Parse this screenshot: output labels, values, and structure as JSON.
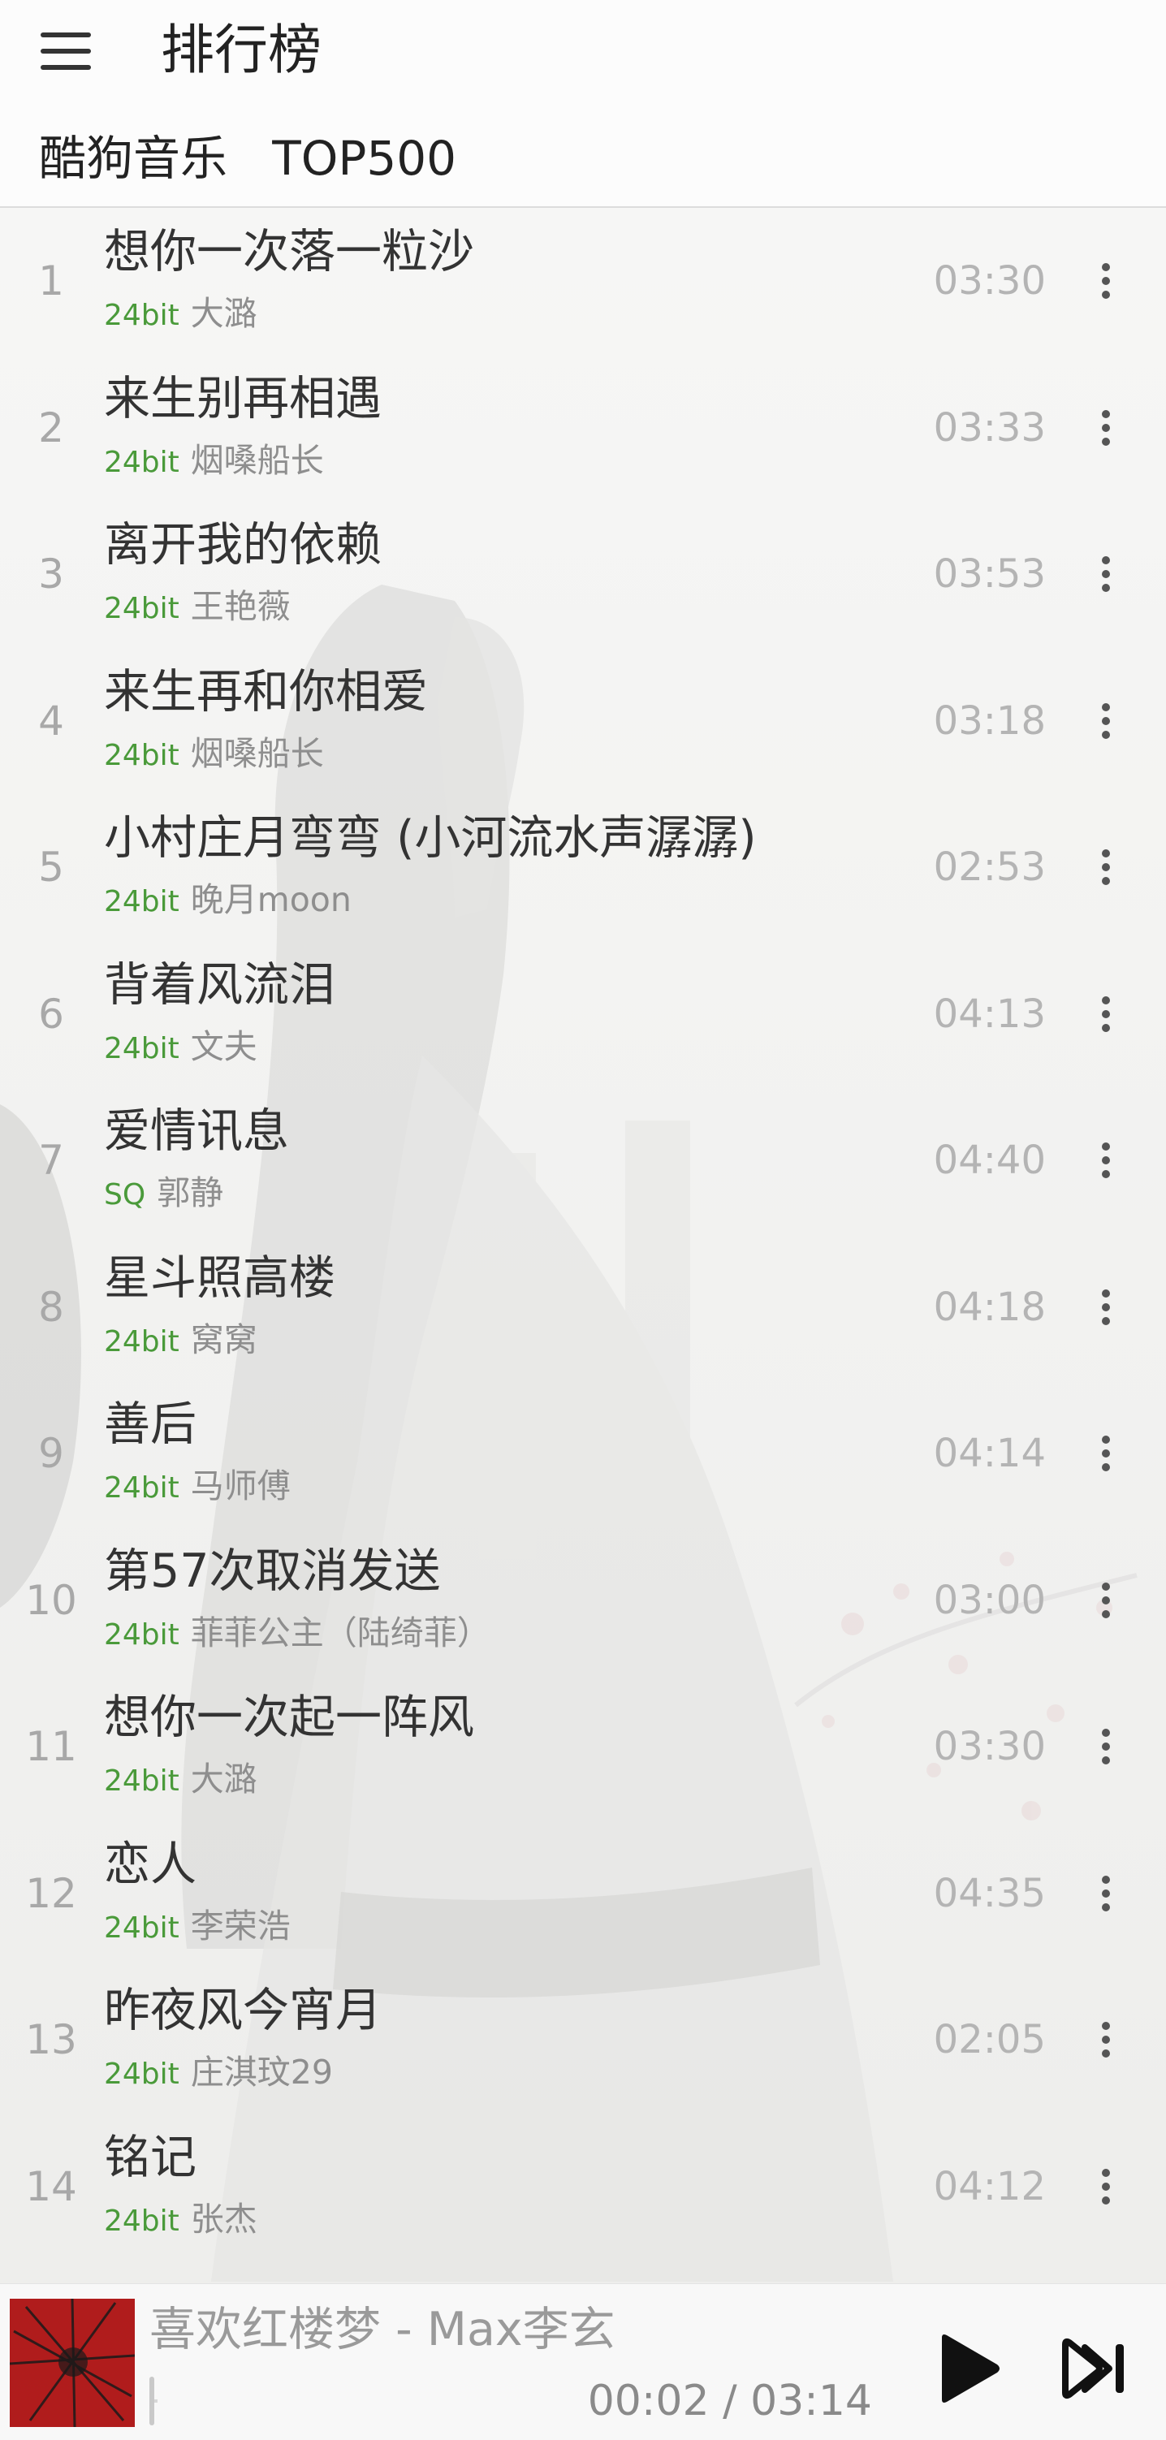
{
  "header": {
    "menu_icon": "hamburger-menu-icon",
    "title": "排行榜",
    "chart_name": "酷狗音乐   TOP500"
  },
  "songs": [
    {
      "rank": "1",
      "title": "想你一次落一粒沙",
      "quality": "24bit",
      "artist": "大潞",
      "duration": "03:30"
    },
    {
      "rank": "2",
      "title": "来生别再相遇",
      "quality": "24bit",
      "artist": "烟嗓船长",
      "duration": "03:33"
    },
    {
      "rank": "3",
      "title": "离开我的依赖",
      "quality": "24bit",
      "artist": "王艳薇",
      "duration": "03:53"
    },
    {
      "rank": "4",
      "title": "来生再和你相爱",
      "quality": "24bit",
      "artist": "烟嗓船长",
      "duration": "03:18"
    },
    {
      "rank": "5",
      "title": "小村庄月弯弯 (小河流水声潺潺)",
      "quality": "24bit",
      "artist": "晚月moon",
      "duration": "02:53"
    },
    {
      "rank": "6",
      "title": "背着风流泪",
      "quality": "24bit",
      "artist": "文夫",
      "duration": "04:13"
    },
    {
      "rank": "7",
      "title": "爱情讯息",
      "quality": "SQ",
      "artist": "郭静",
      "duration": "04:40"
    },
    {
      "rank": "8",
      "title": "星斗照高楼",
      "quality": "24bit",
      "artist": "窝窝",
      "duration": "04:18"
    },
    {
      "rank": "9",
      "title": "善后",
      "quality": "24bit",
      "artist": "马师傅",
      "duration": "04:14"
    },
    {
      "rank": "10",
      "title": "第57次取消发送",
      "quality": "24bit",
      "artist": "菲菲公主（陆绮菲）",
      "duration": "03:00"
    },
    {
      "rank": "11",
      "title": "想你一次起一阵风",
      "quality": "24bit",
      "artist": "大潞",
      "duration": "03:30"
    },
    {
      "rank": "12",
      "title": "恋人",
      "quality": "24bit",
      "artist": "李荣浩",
      "duration": "04:35"
    },
    {
      "rank": "13",
      "title": "昨夜风今宵月",
      "quality": "24bit",
      "artist": "庄淇玟29",
      "duration": "02:05"
    },
    {
      "rank": "14",
      "title": "铭记",
      "quality": "24bit",
      "artist": "张杰",
      "duration": "04:12"
    }
  ],
  "player": {
    "now_playing": "喜欢红楼梦 - Max李玄",
    "time": "00:02 / 03:14",
    "progress": 0.011,
    "play_icon": "play-icon",
    "next_icon": "skip-next-icon",
    "cover_icon": "album-cover"
  },
  "colors": {
    "quality_green": "#4a9a3a",
    "cover_red": "#b01c1c"
  }
}
